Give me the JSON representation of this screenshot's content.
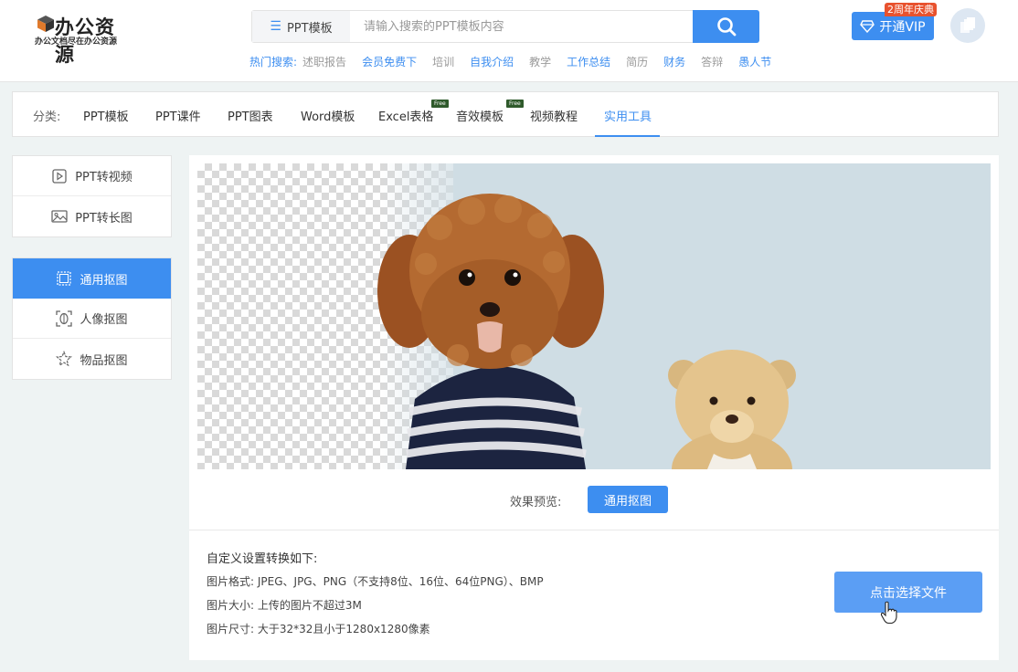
{
  "logo": {
    "title": "办公资源",
    "subtitle": "办公文档尽在办公资源"
  },
  "search": {
    "category": "PPT模板",
    "placeholder": "请输入搜索的PPT模板内容",
    "hot_label": "热门搜索:",
    "hot_items": [
      {
        "text": "述职报告",
        "color": "#9a9a9a"
      },
      {
        "text": "会员免费下",
        "color": "#3d8ef0"
      },
      {
        "text": "培训",
        "color": "#9a9a9a"
      },
      {
        "text": "自我介绍",
        "color": "#3d8ef0"
      },
      {
        "text": "教学",
        "color": "#9a9a9a"
      },
      {
        "text": "工作总结",
        "color": "#3d8ef0"
      },
      {
        "text": "简历",
        "color": "#9a9a9a"
      },
      {
        "text": "财务",
        "color": "#3d8ef0"
      },
      {
        "text": "答辩",
        "color": "#9a9a9a"
      },
      {
        "text": "愚人节",
        "color": "#3d8ef0"
      }
    ]
  },
  "vip": {
    "label": "开通VIP",
    "badge": "2周年庆典"
  },
  "categories": {
    "label": "分类:",
    "items": [
      "PPT模板",
      "PPT课件",
      "PPT图表",
      "Word模板",
      "Excel表格",
      "音效模板",
      "视频教程",
      "实用工具"
    ],
    "free_tag": "Free",
    "active": "实用工具"
  },
  "sidebar": {
    "group1": [
      {
        "label": "PPT转视频",
        "icon": "play-icon"
      },
      {
        "label": "PPT转长图",
        "icon": "image-icon"
      }
    ],
    "group2": [
      {
        "label": "通用抠图",
        "icon": "select-frame-icon",
        "active": true
      },
      {
        "label": "人像抠图",
        "icon": "portrait-icon"
      },
      {
        "label": "物品抠图",
        "icon": "star-outline-icon"
      }
    ]
  },
  "main": {
    "effect_label": "效果预览:",
    "effect_button": "通用抠图",
    "info_title": "自定义设置转换如下:",
    "rows": [
      {
        "key": "图片格式:",
        "value": "JPEG、JPG、PNG（不支持8位、16位、64位PNG）、BMP"
      },
      {
        "key": "图片大小:",
        "value": "上传的图片不超过3M"
      },
      {
        "key": "图片尺寸:",
        "value": "大于32*32且小于1280x1280像素"
      }
    ],
    "upload_button": "点击选择文件"
  },
  "colors": {
    "accent": "#3d8ef0",
    "badge": "#e8522e",
    "free": "#2f5a2b"
  }
}
